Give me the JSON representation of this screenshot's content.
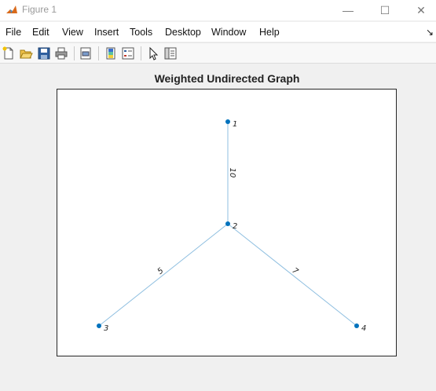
{
  "window": {
    "title": "Figure 1",
    "minimize_glyph": "—",
    "maximize_glyph": "☐",
    "close_glyph": "✕"
  },
  "menu": {
    "items": [
      "File",
      "Edit",
      "View",
      "Insert",
      "Tools",
      "Desktop",
      "Window",
      "Help"
    ],
    "overflow_glyph": "↘"
  },
  "toolbar": {
    "buttons": [
      "new-figure-icon",
      "open-file-icon",
      "save-icon",
      "print-icon",
      "print-preview-icon",
      "colorbar-icon",
      "legend-icon",
      "edit-plot-cursor-icon",
      "property-inspector-icon"
    ]
  },
  "colors": {
    "accent": "#0072bd",
    "edge": "#8fbfe0"
  },
  "chart_data": {
    "type": "graph",
    "title": "Weighted Undirected Graph",
    "nodes": [
      {
        "id": "1",
        "x": 0,
        "y": 1
      },
      {
        "id": "2",
        "x": 0,
        "y": 0
      },
      {
        "id": "3",
        "x": -1,
        "y": -1
      },
      {
        "id": "4",
        "x": 1,
        "y": -1
      }
    ],
    "edges": [
      {
        "source": "1",
        "target": "2",
        "weight": "10"
      },
      {
        "source": "2",
        "target": "3",
        "weight": "5"
      },
      {
        "source": "2",
        "target": "4",
        "weight": "7"
      }
    ]
  }
}
